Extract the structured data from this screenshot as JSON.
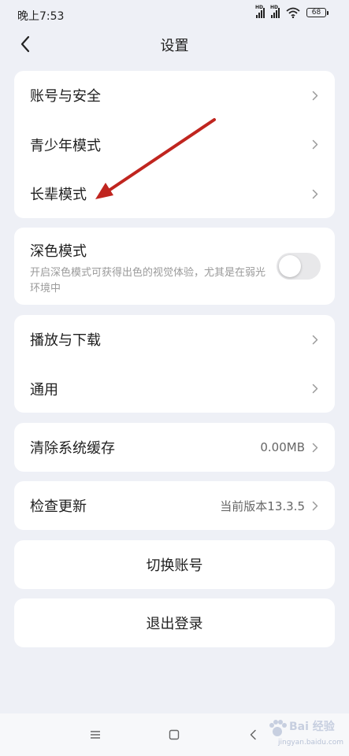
{
  "status_bar": {
    "time": "晚上7:53",
    "signal_badge": "HD",
    "battery": "68"
  },
  "header": {
    "title": "设置"
  },
  "section_account": {
    "items": [
      {
        "label": "账号与安全"
      },
      {
        "label": "青少年模式"
      },
      {
        "label": "长辈模式"
      }
    ]
  },
  "dark_mode": {
    "title": "深色模式",
    "description": "开启深色模式可获得出色的视觉体验，尤其是在弱光环境中",
    "enabled": false
  },
  "section_general": {
    "items": [
      {
        "label": "播放与下载"
      },
      {
        "label": "通用"
      }
    ]
  },
  "cache": {
    "label": "清除系统缓存",
    "value": "0.00MB"
  },
  "update": {
    "label": "检查更新",
    "value": "当前版本13.3.5"
  },
  "switch_account": {
    "label": "切换账号"
  },
  "logout": {
    "label": "退出登录"
  },
  "annotation": {
    "color": "#c0251f"
  },
  "watermark": {
    "text": "Bai 经验",
    "url": "jingyan.baidu.com"
  },
  "icons": {
    "back": "chevron-left-icon",
    "row_arrow": "chevron-right-icon",
    "wifi": "wifi-icon",
    "nav_menu": "menu-icon",
    "nav_home": "square-home-icon",
    "nav_back": "back-icon"
  }
}
